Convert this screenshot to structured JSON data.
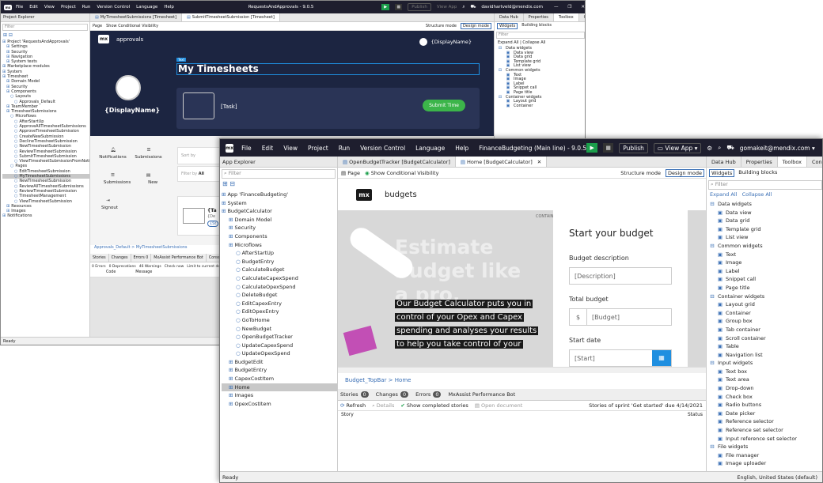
{
  "w1": {
    "menu": [
      "File",
      "Edit",
      "View",
      "Project",
      "Run",
      "Version Control",
      "Language",
      "Help"
    ],
    "title": "RequestsAndApprovals - 9.0.5",
    "publish": "Publish",
    "view_app": "View App",
    "user": "davidhartveld@mendix.com",
    "right_tabs": [
      "Data Hub",
      "Properties",
      "Toolbox",
      "Connector"
    ],
    "explorer_title": "Project Explorer",
    "filter": "Filter",
    "doc_tabs": [
      "MyTimesheetSubmissions [Timesheet]",
      "SubmitTimesheetSubmission [Timesheet]"
    ],
    "page_label": "Page",
    "show_cond": "Show Conditional Visibility",
    "structure_mode": "Structure mode",
    "design_mode": "Design mode",
    "tree": [
      "Project 'RequestsAndApprovals'",
      "Settings",
      "Security",
      "Navigation",
      "System texts",
      "Marketplace modules",
      "System",
      "Timesheet",
      "Domain Model",
      "Security",
      "Components",
      "Layouts",
      "Approvals_Default",
      "TeamMember",
      "TimesheetSubmissions",
      "Microflows",
      "AfterStartUp",
      "ApproveAllTimesheetSubmissions",
      "ApproveTimesheetSubmission",
      "CreateNewSubmission",
      "DeclineTimesheetSubmission",
      "NewTimesheetSubmission",
      "ReviewTimesheetSubmission",
      "SubmitTimesheetSubmission",
      "ViewTimesheetSubmissionFromNotif",
      "Pages",
      "EditTimesheetSubmission",
      "MyTimesheetSubmissions",
      "NewTimesheetSubmission",
      "ReviewAllTimesheetSubmissions",
      "ReviewTimesheetSubmission",
      "TimesheetManagement",
      "ViewTimesheetSubmission",
      "Resources",
      "Images",
      "Notifications"
    ],
    "canvas": {
      "app_name": "approvals",
      "display_name": "{DisplayName}",
      "user_display": "{DisplayName}",
      "text_badge": "Text",
      "heading": "My Timesheets",
      "task": "[Task]",
      "submit": "Submit Time",
      "nav": [
        [
          "Notifications",
          "Submissions"
        ],
        [
          "Submissions",
          "New"
        ],
        [
          "Signout",
          ""
        ]
      ],
      "sort_by": "Sort by",
      "filter_by": "Filter by",
      "filter_all": "All",
      "card_title": "{Ta",
      "card_sub1": "{De",
      "card_sub2": "{St"
    },
    "breadcrumb": "Approvals_Default > MyTimesheetSubmissions",
    "bottom_tabs": [
      "Stories",
      "Changes",
      "Errors 0",
      "MxAssist Performance Bot",
      "Console"
    ],
    "errors_bar": [
      "0 Errors",
      "0 Deprecations",
      "46 Warnings",
      "Check now",
      "Limit to current document"
    ],
    "errors_cols": [
      "Code",
      "Message"
    ],
    "toolbox_tabs": [
      "Widgets",
      "Building blocks"
    ],
    "toolbox": {
      "expand": "Expand All",
      "collapse": "Collapse All",
      "items": [
        "Data widgets",
        "Data view",
        "Data grid",
        "Template grid",
        "List view",
        "Common widgets",
        "Text",
        "Image",
        "Label",
        "Snippet call",
        "Page title",
        "Container widgets",
        "Layout grid",
        "Container"
      ]
    },
    "status": "Ready"
  },
  "w2": {
    "menu": [
      "File",
      "Edit",
      "View",
      "Project",
      "Run",
      "Version Control",
      "Language",
      "Help"
    ],
    "title": "FinanceBudgeting (Main line) - 9.0.5",
    "publish": "Publish",
    "view_app": "View App",
    "user": "gomakeit@mendix.com",
    "right_tabs": [
      "Data Hub",
      "Properties",
      "Toolbox",
      "Connector"
    ],
    "explorer_title": "App Explorer",
    "filter": "Filter",
    "doc_tabs": [
      "OpenBudgetTracker [BudgetCalculator]",
      "Home [BudgetCalculator]"
    ],
    "page_label": "Page",
    "show_cond": "Show Conditional Visibility",
    "structure_mode": "Structure mode",
    "design_mode": "Design mode",
    "tree": [
      "App 'FinanceBudgeting'",
      "System",
      "BudgetCalculator",
      "Domain Model",
      "Security",
      "Components",
      "Microflows",
      "AfterStartUp",
      "BudgetEntry",
      "CalculateBudget",
      "CalculateCapexSpend",
      "CalculateOpexSpend",
      "DeleteBudget",
      "EditCapexEntry",
      "EditOpexEntry",
      "GoToHome",
      "NewBudget",
      "OpenBudgetTracker",
      "UpdateCapexSpend",
      "UpdateOpexSpend",
      "BudgetEdit",
      "BudgetEntry",
      "CapexCostItem",
      "Home",
      "Images",
      "OpexCostItem"
    ],
    "canvas": {
      "app_name": "budgets",
      "hero_heading": "Estimate budget like a pro.",
      "hero_text": "Our Budget Calculator puts you in control of your Opex and Capex spending and analyses your results to help you take control of your",
      "container_label": "CONTAIN",
      "form_title": "Start your budget",
      "desc_label": "Budget description",
      "desc_ph": "[Description]",
      "total_label": "Total budget",
      "currency": "$",
      "budget_ph": "[Budget]",
      "start_label": "Start date",
      "start_ph": "[Start]"
    },
    "breadcrumb": "Budget_TopBar > Home",
    "bottom_tabs": [
      {
        "label": "Stories",
        "badge": "0"
      },
      {
        "label": "Changes",
        "badge": "0"
      },
      {
        "label": "Errors",
        "badge": "0"
      },
      {
        "label": "MxAssist Performance Bot",
        "badge": ""
      }
    ],
    "stories_bar": {
      "refresh": "Refresh",
      "details": "Details",
      "show_completed": "Show completed stories",
      "open_doc": "Open document",
      "sprint": "Stories of sprint 'Get started' due 4/14/2021"
    },
    "stories_cols": [
      "Story",
      "Status"
    ],
    "toolbox_tabs": [
      "Widgets",
      "Building blocks"
    ],
    "toolbox": {
      "expand": "Expand All",
      "collapse": "Collapse All",
      "items": [
        "Data widgets",
        "Data view",
        "Data grid",
        "Template grid",
        "List view",
        "Common widgets",
        "Text",
        "Image",
        "Label",
        "Snippet call",
        "Page title",
        "Container widgets",
        "Layout grid",
        "Container",
        "Group box",
        "Tab container",
        "Scroll container",
        "Table",
        "Navigation list",
        "Input widgets",
        "Text box",
        "Text area",
        "Drop-down",
        "Check box",
        "Radio buttons",
        "Date picker",
        "Reference selector",
        "Reference set selector",
        "Input reference set selector",
        "File widgets",
        "File manager",
        "Image uploader"
      ]
    },
    "status": "Ready",
    "locale": "English, United States (default)"
  },
  "colors": {
    "title_bg": "#1e1e2e",
    "canvas_dark": "#1c2541",
    "accent": "#1b9e4b",
    "link": "#3a6fb5",
    "button_blue": "#1f8fe0",
    "submit_green": "#3cb54a"
  }
}
